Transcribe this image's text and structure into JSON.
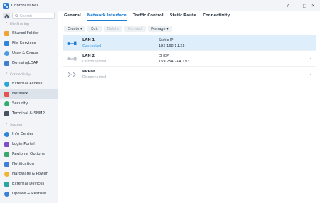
{
  "window": {
    "title": "Control Panel",
    "help": "?",
    "minimize": "—",
    "maximize": "□",
    "close": "✕"
  },
  "sidebar": {
    "search_placeholder": "Search",
    "groups": [
      {
        "label": "File Sharing",
        "items": [
          {
            "label": "Shared Folder",
            "icon": "shared-folder-icon",
            "color": "#f0a335"
          },
          {
            "label": "File Services",
            "icon": "file-services-icon",
            "color": "#2f86d9"
          },
          {
            "label": "User & Group",
            "icon": "user-group-icon",
            "color": "#4a9be4"
          },
          {
            "label": "Domain/LDAP",
            "icon": "domain-ldap-icon",
            "color": "#3f7fcf"
          }
        ]
      },
      {
        "label": "Connectivity",
        "items": [
          {
            "label": "External Access",
            "icon": "external-access-icon",
            "color": "#27a6d8"
          },
          {
            "label": "Network",
            "icon": "network-icon",
            "color": "#e3544f",
            "active": true
          },
          {
            "label": "Security",
            "icon": "security-icon",
            "color": "#2fae6b"
          },
          {
            "label": "Terminal & SNMP",
            "icon": "terminal-icon",
            "color": "#46525f"
          }
        ]
      },
      {
        "label": "System",
        "items": [
          {
            "label": "Info Center",
            "icon": "info-center-icon",
            "color": "#2f86d9"
          },
          {
            "label": "Login Portal",
            "icon": "login-portal-icon",
            "color": "#7b4fc6"
          },
          {
            "label": "Regional Options",
            "icon": "regional-options-icon",
            "color": "#3aa76d"
          },
          {
            "label": "Notification",
            "icon": "notification-icon",
            "color": "#3d7fd6"
          },
          {
            "label": "Hardware & Power",
            "icon": "hardware-power-icon",
            "color": "#f2b431"
          },
          {
            "label": "External Devices",
            "icon": "external-devices-icon",
            "color": "#2aa5a0"
          },
          {
            "label": "Update & Restore",
            "icon": "update-restore-icon",
            "color": "#3b82d6"
          }
        ]
      }
    ]
  },
  "tabs": [
    {
      "label": "General"
    },
    {
      "label": "Network Interface",
      "active": true
    },
    {
      "label": "Traffic Control"
    },
    {
      "label": "Static Route"
    },
    {
      "label": "Connectivity"
    }
  ],
  "toolbar": {
    "create": "Create",
    "edit": "Edit",
    "delete": "Delete",
    "connect": "Connect",
    "manage": "Manage"
  },
  "interfaces": [
    {
      "name": "LAN 1",
      "status": "Connected",
      "mode": "Static IP",
      "ip": "192.168.1.123",
      "state": "connected"
    },
    {
      "name": "LAN 2",
      "status": "Disconnected",
      "mode": "DHCP",
      "ip": "169.254.244.192",
      "state": "disconnected"
    },
    {
      "name": "PPPoE",
      "status": "Disconnected",
      "mode": "",
      "ip": "--",
      "state": "disconnected"
    }
  ],
  "colors": {
    "accent": "#1f7fd5",
    "connected": "#3191e0",
    "selected_row": "#dfeefb"
  }
}
